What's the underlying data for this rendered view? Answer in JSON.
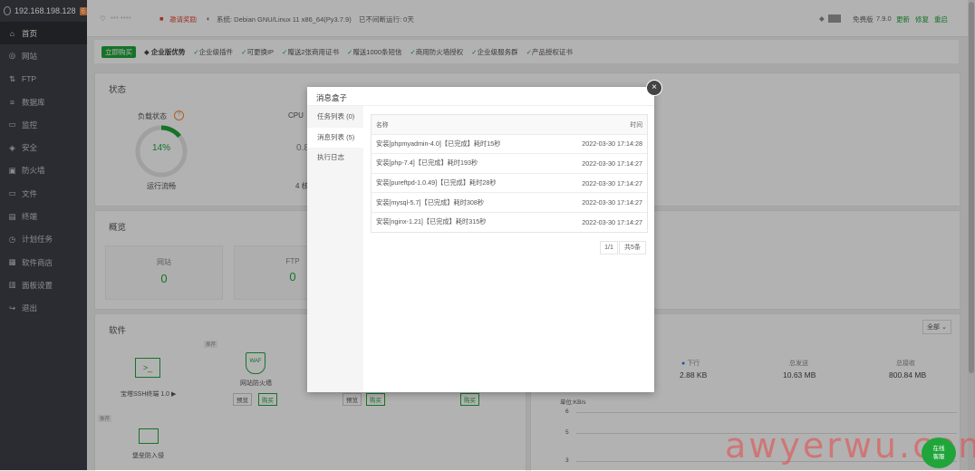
{
  "sidebar": {
    "ip": "192.168.198.128",
    "badge": "6",
    "items": [
      {
        "label": "首页",
        "icon": "home-icon"
      },
      {
        "label": "网站",
        "icon": "globe-icon"
      },
      {
        "label": "FTP",
        "icon": "ftp-icon"
      },
      {
        "label": "数据库",
        "icon": "database-icon"
      },
      {
        "label": "监控",
        "icon": "monitor-icon"
      },
      {
        "label": "安全",
        "icon": "shield-icon"
      },
      {
        "label": "防火墙",
        "icon": "firewall-icon"
      },
      {
        "label": "文件",
        "icon": "folder-icon"
      },
      {
        "label": "终端",
        "icon": "terminal-icon"
      },
      {
        "label": "计划任务",
        "icon": "clock-icon"
      },
      {
        "label": "软件商店",
        "icon": "store-icon"
      },
      {
        "label": "面板设置",
        "icon": "settings-icon"
      },
      {
        "label": "退出",
        "icon": "logout-icon"
      }
    ]
  },
  "topbar": {
    "user": "*** ****",
    "bind_label": "邀请奖励",
    "system": "系统:  Debian GNU/Linux 11 x86_64(Py3.7.9)",
    "uptime": "已不间断运行: 0天",
    "edition": "免费版",
    "version": "7.9.0",
    "update": "更新",
    "repair": "修复",
    "restart": "重启"
  },
  "promo": {
    "button": "立即购买",
    "title": "企业版优势",
    "features": [
      "企业级插件",
      "可更换IP",
      "赠送2张商用证书",
      "赠送1000条短信",
      "商用防火墙授权",
      "企业级服务群",
      "产品授权证书"
    ]
  },
  "status": {
    "title": "状态",
    "load_label": "负载状态",
    "load_value": "14%",
    "load_text": "运行流畅",
    "cpu_label": "CPU",
    "cpu_value": "0.8",
    "cpu_cores": "4 核"
  },
  "overview": {
    "title": "概览",
    "site_label": "网站",
    "site_value": "0",
    "ftp_label": "FTP",
    "ftp_value": "0"
  },
  "software": {
    "title": "软件",
    "filter": "全部",
    "items": [
      {
        "name": "宝塔SSH终端 1.0 ▶",
        "tag": ""
      },
      {
        "name": "网站防火墙",
        "tag": "推荐",
        "btn1": "预览",
        "btn2": "购买"
      }
    ],
    "btn_preview": "预览",
    "btn_buy": "购买",
    "tag2": "推荐",
    "item3": "堡垒防入侵"
  },
  "traffic": {
    "down_label": "下行",
    "down_value": "2.88 KB",
    "sent_label": "总发送",
    "sent_value": "10.63 MB",
    "recv_label": "总接收",
    "recv_value": "800.84 MB",
    "unit": "单位:KB/s",
    "y_ticks": [
      "6",
      "5",
      "3"
    ]
  },
  "modal": {
    "title": "消息盒子",
    "tabs": [
      {
        "label": "任务列表 (0)"
      },
      {
        "label": "消息列表 (5)"
      },
      {
        "label": "执行日志"
      }
    ],
    "columns": {
      "name": "名称",
      "time": "时间"
    },
    "rows": [
      {
        "name": "安装[phpmyadmin-4.0]【已完成】耗时15秒",
        "time": "2022-03-30 17:14:28"
      },
      {
        "name": "安装[php-7.4]【已完成】耗时193秒",
        "time": "2022-03-30 17:14:27"
      },
      {
        "name": "安装[pureftpd-1.0.49]【已完成】耗时28秒",
        "time": "2022-03-30 17:14:27"
      },
      {
        "name": "安装[mysql-5.7]【已完成】耗时308秒",
        "time": "2022-03-30 17:14:27"
      },
      {
        "name": "安装[nginx-1.21]【已完成】耗时315秒",
        "time": "2022-03-30 17:14:27"
      }
    ],
    "page": "1/1",
    "total": "共5条",
    "close": "×"
  },
  "watermark": "awyerwu.com",
  "service_line1": "在线",
  "service_line2": "客服"
}
